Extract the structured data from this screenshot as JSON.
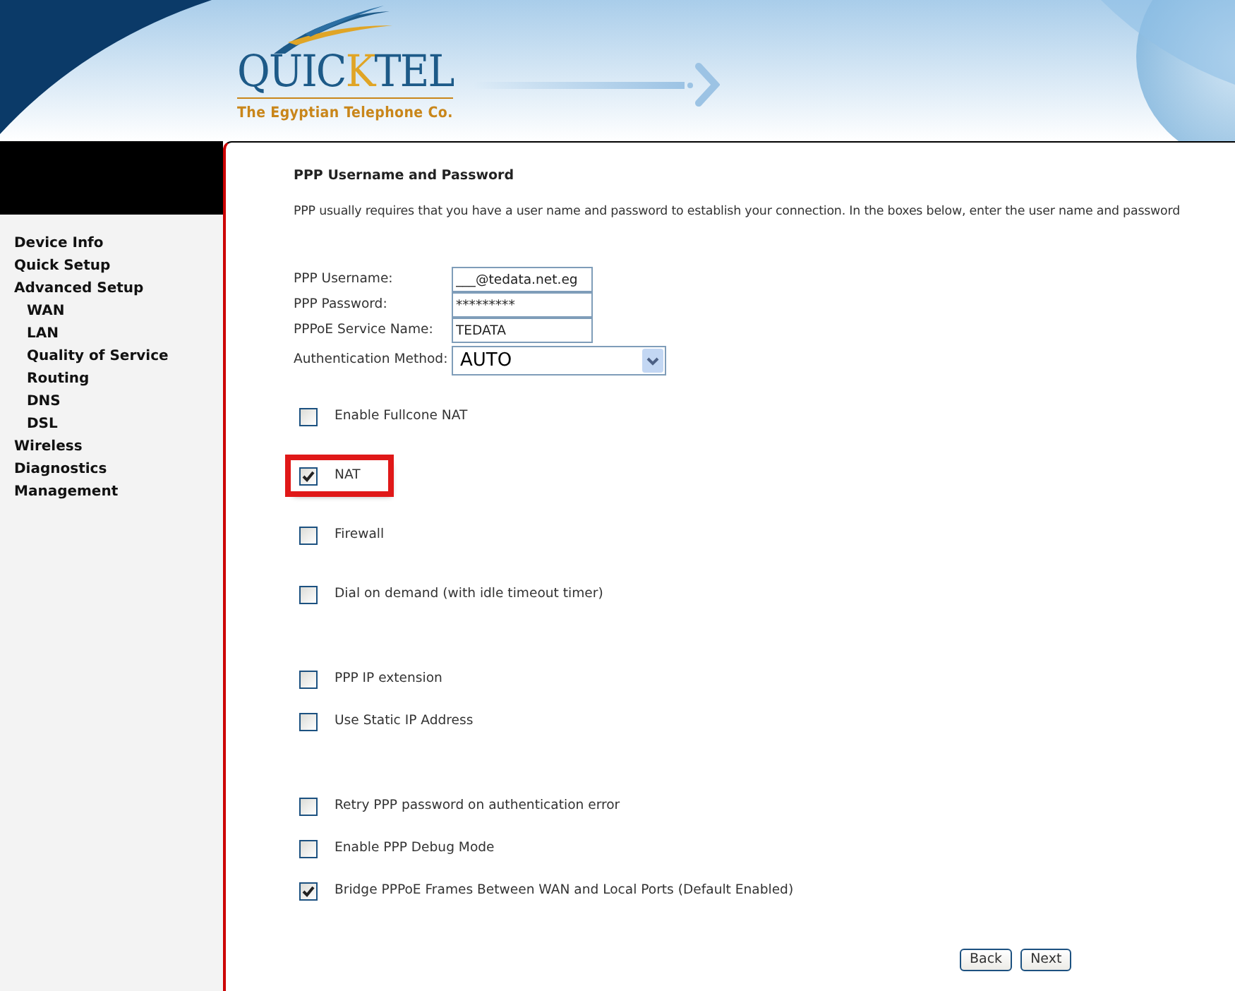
{
  "header": {
    "logo": {
      "parts": [
        {
          "text": "QUIC",
          "color": "#1d5a88"
        },
        {
          "text": "K",
          "color": "#e0a526"
        },
        {
          "text": "TEL",
          "color": "#1d5a88"
        }
      ],
      "tagline": "The Egyptian Telephone Co."
    }
  },
  "sidebar": {
    "items": [
      {
        "label": "Device Info"
      },
      {
        "label": "Quick Setup"
      },
      {
        "label": "Advanced Setup",
        "children": [
          {
            "label": "WAN"
          },
          {
            "label": "LAN"
          },
          {
            "label": "Quality of Service"
          },
          {
            "label": "Routing"
          },
          {
            "label": "DNS"
          },
          {
            "label": "DSL"
          }
        ]
      },
      {
        "label": "Wireless"
      },
      {
        "label": "Diagnostics"
      },
      {
        "label": "Management"
      }
    ]
  },
  "content": {
    "title": "PPP Username and Password",
    "description": "PPP usually requires that you have a user name and password to establish your connection. In the boxes below, enter the user name and password",
    "fields": [
      {
        "kind": "text",
        "label": "PPP Username:",
        "value": "___@tedata.net.eg"
      },
      {
        "kind": "text",
        "label": "PPP Password:",
        "value": "*********"
      },
      {
        "kind": "text",
        "label": "PPPoE Service Name:",
        "value": "TEDATA"
      },
      {
        "kind": "select",
        "label": "Authentication Method:",
        "value": "AUTO"
      }
    ],
    "options": [
      {
        "label": "Enable Fullcone NAT",
        "checked": false,
        "highlighted": false
      },
      {
        "label": "NAT",
        "checked": true,
        "highlighted": true
      },
      {
        "label": "Firewall",
        "checked": false,
        "highlighted": false
      },
      {
        "label": "Dial on demand (with idle timeout timer)",
        "checked": false,
        "highlighted": false
      },
      {
        "label": "PPP IP extension",
        "checked": false,
        "highlighted": false
      },
      {
        "label": "Use Static IP Address",
        "checked": false,
        "highlighted": false
      },
      {
        "label": "Retry PPP password on authentication error",
        "checked": false,
        "highlighted": false
      },
      {
        "label": "Enable PPP Debug Mode",
        "checked": false,
        "highlighted": false
      },
      {
        "label": "Bridge PPPoE Frames Between WAN and Local Ports (Default Enabled)",
        "checked": true,
        "highlighted": false
      }
    ],
    "buttons": [
      "Back",
      "Next"
    ]
  }
}
